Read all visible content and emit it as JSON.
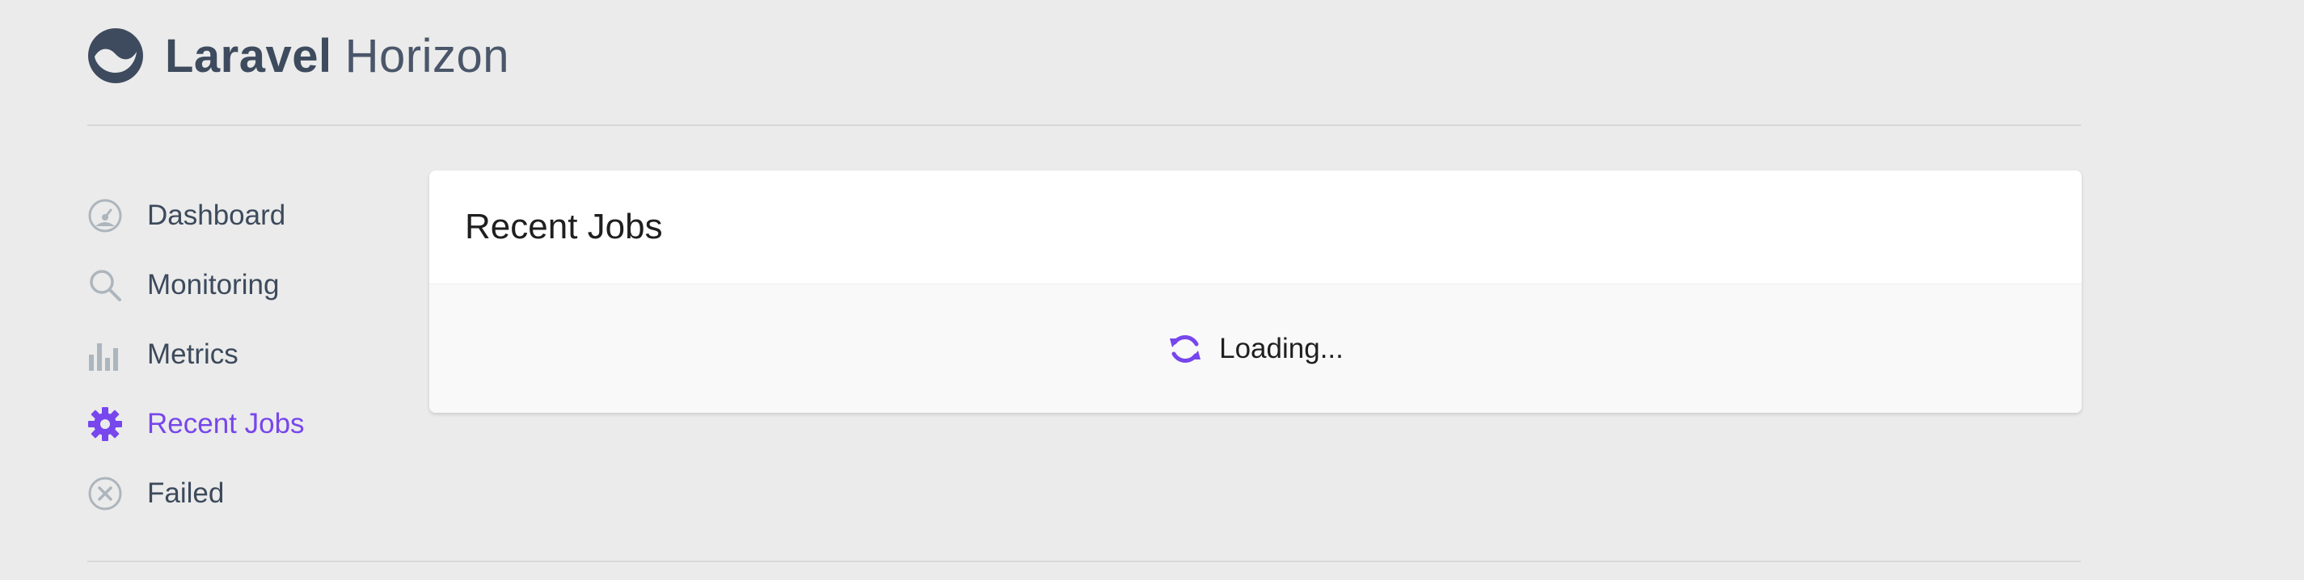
{
  "brand": {
    "bold": "Laravel",
    "light": "Horizon",
    "logo_icon": "horizon-logo-icon"
  },
  "sidebar": {
    "items": [
      {
        "label": "Dashboard",
        "icon": "dashboard-icon",
        "active": false
      },
      {
        "label": "Monitoring",
        "icon": "search-icon",
        "active": false
      },
      {
        "label": "Metrics",
        "icon": "bar-chart-icon",
        "active": false
      },
      {
        "label": "Recent Jobs",
        "icon": "gear-icon",
        "active": true
      },
      {
        "label": "Failed",
        "icon": "close-circle-icon",
        "active": false
      }
    ]
  },
  "main": {
    "title": "Recent Jobs",
    "loading_text": "Loading...",
    "loading_icon": "refresh-icon"
  },
  "colors": {
    "accent": "#7746ec",
    "background": "#ebebeb",
    "text": "#3c4a5c",
    "icon_gray": "#adb5bd",
    "card": "#ffffff",
    "card_body": "#f9f9f9"
  }
}
